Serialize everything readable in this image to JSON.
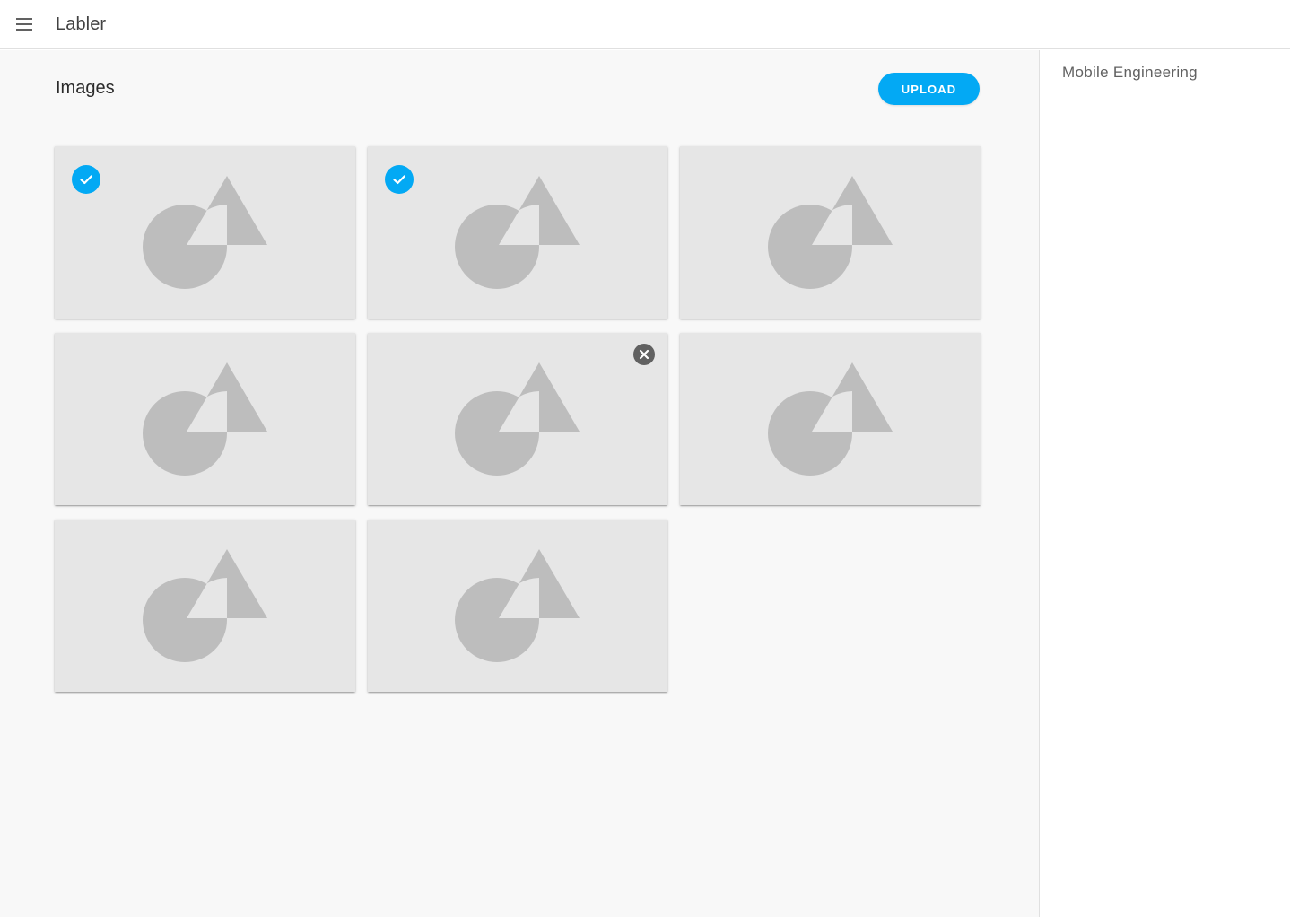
{
  "app": {
    "title": "Labler",
    "menu_icon": "hamburger-menu-icon"
  },
  "main": {
    "section_title": "Images",
    "upload_label": "UPLOAD",
    "accent_color": "#03a9f4",
    "images": [
      {
        "state": "selected",
        "icon": "image-placeholder-icon"
      },
      {
        "state": "selected",
        "icon": "image-placeholder-icon"
      },
      {
        "state": "none",
        "icon": "image-placeholder-icon"
      },
      {
        "state": "none",
        "icon": "image-placeholder-icon"
      },
      {
        "state": "removable",
        "icon": "image-placeholder-icon"
      },
      {
        "state": "none",
        "icon": "image-placeholder-icon"
      },
      {
        "state": "none",
        "icon": "image-placeholder-icon"
      },
      {
        "state": "none",
        "icon": "image-placeholder-icon"
      }
    ]
  },
  "side_panel": {
    "title": "Mobile Engineering"
  }
}
